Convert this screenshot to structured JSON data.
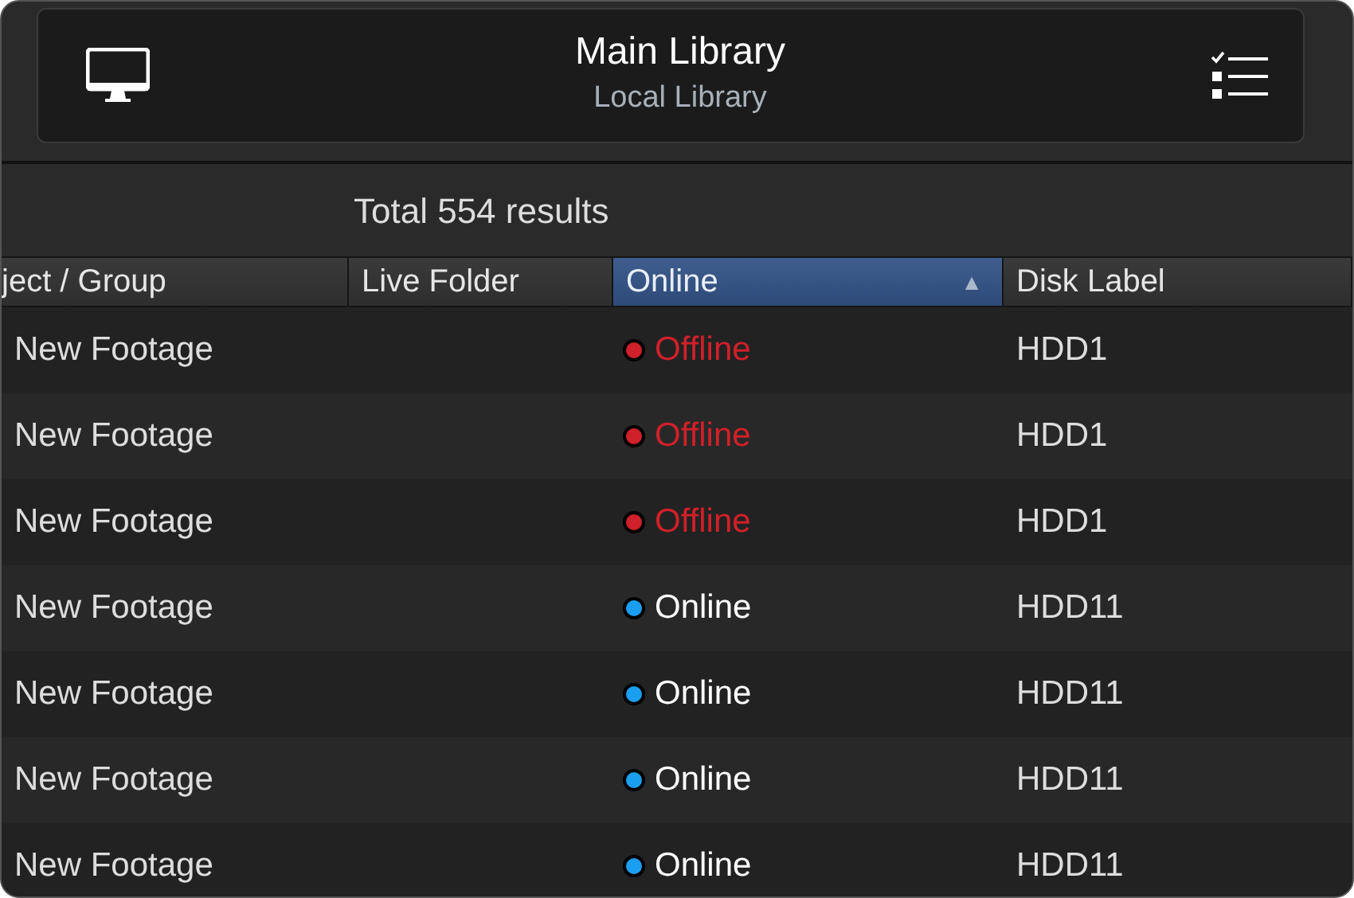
{
  "header": {
    "title": "Main Library",
    "subtitle": "Local Library"
  },
  "summary": "Total 554 results",
  "table": {
    "columns": [
      {
        "label": "ject / Group",
        "selected": false
      },
      {
        "label": "Live Folder",
        "selected": false
      },
      {
        "label": "Online",
        "selected": true,
        "sort_indicator": "▲"
      },
      {
        "label": "Disk Label",
        "selected": false
      }
    ],
    "rows": [
      {
        "group": "New Footage",
        "status": {
          "kind": "offline",
          "label": "Offline",
          "color": "#d0202a"
        },
        "disk": "HDD1"
      },
      {
        "group": "New Footage",
        "status": {
          "kind": "offline",
          "label": "Offline",
          "color": "#d0202a"
        },
        "disk": "HDD1"
      },
      {
        "group": "New Footage",
        "status": {
          "kind": "offline",
          "label": "Offline",
          "color": "#d0202a"
        },
        "disk": "HDD1"
      },
      {
        "group": "New Footage",
        "status": {
          "kind": "online",
          "label": "Online",
          "color": "#1a9ff0"
        },
        "disk": "HDD11"
      },
      {
        "group": "New Footage",
        "status": {
          "kind": "online",
          "label": "Online",
          "color": "#1a9ff0"
        },
        "disk": "HDD11"
      },
      {
        "group": "New Footage",
        "status": {
          "kind": "online",
          "label": "Online",
          "color": "#1a9ff0"
        },
        "disk": "HDD11"
      },
      {
        "group": "New Footage",
        "status": {
          "kind": "online",
          "label": "Online",
          "color": "#1a9ff0"
        },
        "disk": "HDD11"
      }
    ]
  }
}
